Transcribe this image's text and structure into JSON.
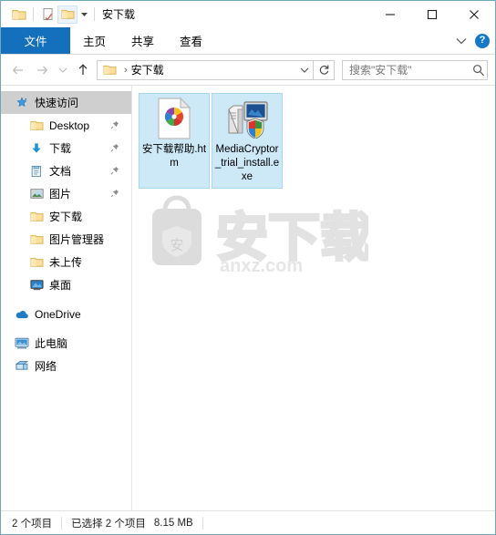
{
  "window": {
    "title": "安下载",
    "quick_access_toolbar": [
      {
        "name": "folder-icon",
        "tooltip": "安下载"
      },
      {
        "name": "properties-icon",
        "tooltip": "属性"
      },
      {
        "name": "new-folder-icon",
        "tooltip": "新建文件夹"
      }
    ],
    "controls": {
      "minimize": "最小化",
      "maximize": "最大化",
      "close": "关闭"
    }
  },
  "ribbon": {
    "tabs": [
      {
        "label": "文件",
        "active": true
      },
      {
        "label": "主页",
        "active": false
      },
      {
        "label": "共享",
        "active": false
      },
      {
        "label": "查看",
        "active": false
      }
    ],
    "expand_label": "展开功能区",
    "help_label": "?"
  },
  "address": {
    "back": "后退",
    "forward": "前进",
    "history": "最近浏览的位置",
    "up": "上移到",
    "crumb": "安下载",
    "separator": "›",
    "refresh": "刷新"
  },
  "search": {
    "placeholder": "搜索\"安下载\"",
    "value": ""
  },
  "sidebar": {
    "items": [
      {
        "label": "快速访问",
        "icon": "star-icon",
        "level": 0,
        "selected": true,
        "pinned": false
      },
      {
        "label": "Desktop",
        "icon": "folder-icon",
        "level": 1,
        "selected": false,
        "pinned": true
      },
      {
        "label": "下载",
        "icon": "download-icon",
        "level": 1,
        "selected": false,
        "pinned": true
      },
      {
        "label": "文档",
        "icon": "documents-icon",
        "level": 1,
        "selected": false,
        "pinned": true
      },
      {
        "label": "图片",
        "icon": "pictures-icon",
        "level": 1,
        "selected": false,
        "pinned": true
      },
      {
        "label": "安下载",
        "icon": "folder-icon",
        "level": 1,
        "selected": false,
        "pinned": false
      },
      {
        "label": "图片管理器",
        "icon": "folder-icon",
        "level": 1,
        "selected": false,
        "pinned": false
      },
      {
        "label": "未上传",
        "icon": "folder-icon",
        "level": 1,
        "selected": false,
        "pinned": false
      },
      {
        "label": "桌面",
        "icon": "desktop-icon",
        "level": 1,
        "selected": false,
        "pinned": false
      },
      {
        "label": "OneDrive",
        "icon": "onedrive-icon",
        "level": 0,
        "selected": false,
        "pinned": false
      },
      {
        "label": "此电脑",
        "icon": "this-pc-icon",
        "level": 0,
        "selected": false,
        "pinned": false
      },
      {
        "label": "网络",
        "icon": "network-icon",
        "level": 0,
        "selected": false,
        "pinned": false
      }
    ]
  },
  "files": [
    {
      "name": "安下载帮助.htm",
      "icon": "html-file-icon",
      "selected": true
    },
    {
      "name": "MediaCryptor_trial_install.exe",
      "icon": "exe-installer-icon",
      "selected": true
    }
  ],
  "watermark": {
    "text": "安下载",
    "domain": "anxz.com",
    "badge": "安"
  },
  "status": {
    "item_count": "2 个项目",
    "selection": "已选择 2 个项目",
    "size": "8.15 MB"
  },
  "colors": {
    "accent": "#1470bd",
    "selection": "#cde8f7",
    "selection_border": "#a8d8ef",
    "nav_selected": "#cfcfcf",
    "window_border": "#6fa8bb",
    "folder": "#fbdf9a",
    "help_blue": "#1579c8"
  }
}
